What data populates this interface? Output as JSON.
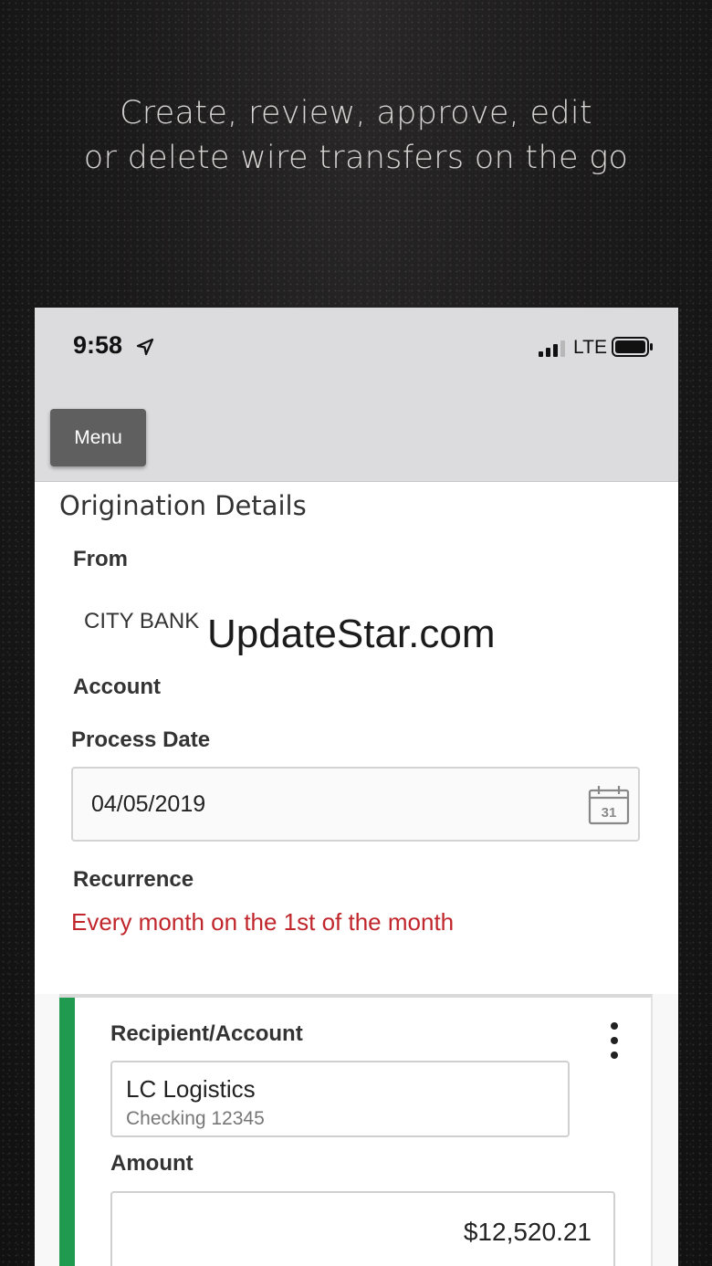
{
  "headline": {
    "line1": "Create, review, approve, edit",
    "line2": "or delete wire transfers on the go"
  },
  "status_bar": {
    "time": "9:58",
    "network": "LTE",
    "icons": [
      "location-arrow-icon",
      "signal-icon",
      "battery-icon"
    ]
  },
  "nav": {
    "menu_label": "Menu"
  },
  "origination": {
    "title": "Origination Details",
    "from_label": "From",
    "from_value": "CITY BANK",
    "account_label": "Account",
    "process_date_label": "Process Date",
    "process_date_value": "04/05/2019",
    "calendar_day": "31",
    "recurrence_label": "Recurrence",
    "recurrence_value": "Every month on the 1st of the month"
  },
  "watermark": "UpdateStar.com",
  "recipient_card": {
    "recipient_label": "Recipient/Account",
    "recipient_name": "LC Logistics",
    "recipient_account": "Checking 12345",
    "amount_label": "Amount",
    "amount_value": "$12,520.21"
  },
  "colors": {
    "accent_green": "#1f9a4f",
    "recurrence_red": "#c0262b",
    "menu_button": "#5f5f60",
    "topbar": "#dcdcde"
  }
}
